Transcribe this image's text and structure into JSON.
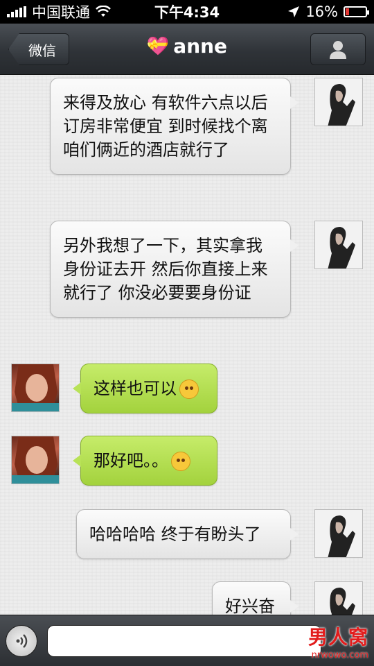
{
  "status_bar": {
    "carrier": "中国联通",
    "time": "下午4:34",
    "battery_text": "16%",
    "battery_level": 0.16
  },
  "nav": {
    "back_label": "微信",
    "title": "anne",
    "title_icon": "heart-gift-icon",
    "profile_icon": "person-icon"
  },
  "messages": [
    {
      "side": "right",
      "sender": "me",
      "text": "来得及放心 有软件六点以后订房非常便宜 到时候找个离咱们俩近的酒店就行了"
    },
    {
      "side": "right",
      "sender": "me",
      "text": "另外我想了一下，其实拿我身份证去开 然后你直接上来就行了 你没必要要身份证"
    },
    {
      "side": "left",
      "sender": "her",
      "text": "这样也可以",
      "emoji": "angry-face-icon"
    },
    {
      "side": "left",
      "sender": "her",
      "text": "那好吧。。",
      "emoji": "smile-face-icon"
    },
    {
      "side": "right",
      "sender": "me",
      "text": "哈哈哈哈 终于有盼头了"
    },
    {
      "side": "right",
      "sender": "me",
      "text": "好兴奋"
    }
  ],
  "input_bar": {
    "voice_icon": "voice-icon",
    "placeholder": ""
  },
  "watermark": {
    "logo_text": "男人窝",
    "url_text": "nrwowo.com"
  }
}
